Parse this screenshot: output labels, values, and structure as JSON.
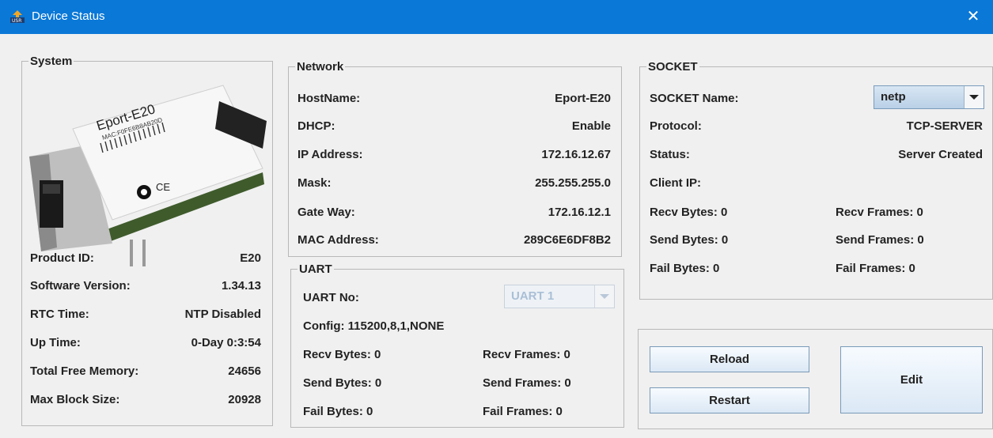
{
  "window": {
    "title": "Device Status",
    "close_label": "✕"
  },
  "system": {
    "legend": "System",
    "image_text": {
      "model": "Eport-E20",
      "mac": "MAC:F0FE6B8AB20D"
    },
    "rows": [
      {
        "label": "Product ID:",
        "value": "E20"
      },
      {
        "label": "Software Version:",
        "value": "1.34.13"
      },
      {
        "label": "RTC Time:",
        "value": "NTP Disabled"
      },
      {
        "label": "Up Time:",
        "value": "0-Day 0:3:54"
      },
      {
        "label": "Total Free Memory:",
        "value": "24656"
      },
      {
        "label": "Max Block Size:",
        "value": "20928"
      }
    ]
  },
  "network": {
    "legend": "Network",
    "rows": [
      {
        "label": "HostName:",
        "value": "Eport-E20"
      },
      {
        "label": "DHCP:",
        "value": "Enable"
      },
      {
        "label": "IP Address:",
        "value": "172.16.12.67"
      },
      {
        "label": "Mask:",
        "value": "255.255.255.0"
      },
      {
        "label": "Gate Way:",
        "value": "172.16.12.1"
      },
      {
        "label": "MAC Address:",
        "value": "289C6E6DF8B2"
      }
    ]
  },
  "uart": {
    "legend": "UART",
    "uart_no_label": "UART No:",
    "uart_no_value": "UART 1",
    "config": "Config: 115200,8,1,NONE",
    "recv_bytes": "Recv Bytes: 0",
    "recv_frames": "Recv Frames: 0",
    "send_bytes": "Send Bytes: 0",
    "send_frames": "Send Frames: 0",
    "fail_bytes": "Fail Bytes: 0",
    "fail_frames": "Fail Frames: 0"
  },
  "socket": {
    "legend": "SOCKET",
    "name_label": "SOCKET Name:",
    "name_value": "netp",
    "protocol_label": "Protocol:",
    "protocol_value": "TCP-SERVER",
    "status_label": "Status:",
    "status_value": "Server Created",
    "client_ip_label": "Client IP:",
    "client_ip_value": "",
    "recv_bytes": "Recv Bytes: 0",
    "recv_frames": "Recv Frames: 0",
    "send_bytes": "Send Bytes: 0",
    "send_frames": "Send Frames: 0",
    "fail_bytes": "Fail Bytes: 0",
    "fail_frames": "Fail Frames: 0"
  },
  "actions": {
    "reload": "Reload",
    "restart": "Restart",
    "edit": "Edit"
  }
}
